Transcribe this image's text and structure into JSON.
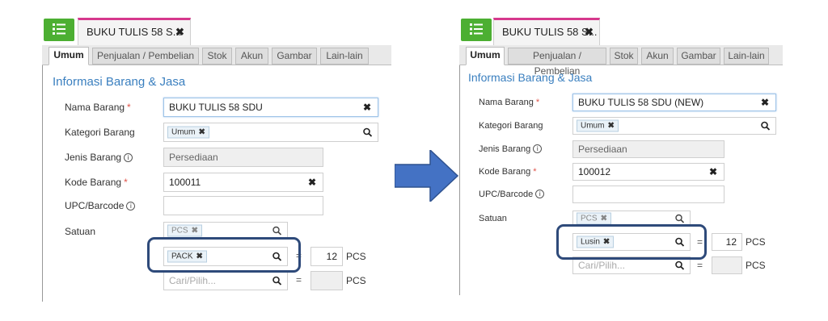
{
  "before": {
    "doc_tab": "BUKU TULIS 58 S...",
    "tabs": [
      "Umum",
      "Penjualan / Pembelian",
      "Stok",
      "Akun",
      "Gambar",
      "Lain-lain"
    ],
    "section_title": "Informasi Barang & Jasa",
    "labels": {
      "nama": "Nama Barang",
      "kategori": "Kategori Barang",
      "jenis": "Jenis Barang",
      "kode": "Kode Barang",
      "upc": "UPC/Barcode",
      "satuan": "Satuan"
    },
    "nama_value": "BUKU TULIS 58 SDU",
    "kategori_chip": "Umum",
    "jenis_value": "Persediaan",
    "kode_value": "100011",
    "upc_value": "",
    "satuan_base_chip": "PCS",
    "satuan_rows": [
      {
        "chip": "PACK",
        "placeholder": "",
        "qty": "12",
        "unit": "PCS"
      },
      {
        "chip": "",
        "placeholder": "Cari/Pilih...",
        "qty": "",
        "unit": "PCS"
      }
    ]
  },
  "after": {
    "doc_tab": "BUKU TULIS 58 S...",
    "tabs": [
      "Umum",
      "Penjualan / Pembelian",
      "Stok",
      "Akun",
      "Gambar",
      "Lain-lain"
    ],
    "section_title": "Informasi Barang & Jasa",
    "labels": {
      "nama": "Nama Barang",
      "kategori": "Kategori Barang",
      "jenis": "Jenis Barang",
      "kode": "Kode Barang",
      "upc": "UPC/Barcode",
      "satuan": "Satuan"
    },
    "nama_value": "BUKU TULIS 58 SDU (NEW)",
    "kategori_chip": "Umum",
    "jenis_value": "Persediaan",
    "kode_value": "100012",
    "upc_value": "",
    "satuan_base_chip": "PCS",
    "satuan_rows": [
      {
        "chip": "Lusin",
        "placeholder": "",
        "qty": "12",
        "unit": "PCS"
      },
      {
        "chip": "",
        "placeholder": "Cari/Pilih...",
        "qty": "",
        "unit": "PCS"
      }
    ]
  },
  "symbols": {
    "close": "✖",
    "equals": "="
  },
  "icons": [
    "list-menu-icon",
    "close-icon",
    "search-icon",
    "info-icon",
    "right-arrow-icon"
  ],
  "colors": {
    "menu_green": "#4caf32",
    "active_tab_border": "#d6388c",
    "section_blue": "#3a7fbf",
    "required_red": "#e0554b",
    "highlight_navy": "#2e4a7a",
    "arrow_blue": "#4472c4"
  }
}
